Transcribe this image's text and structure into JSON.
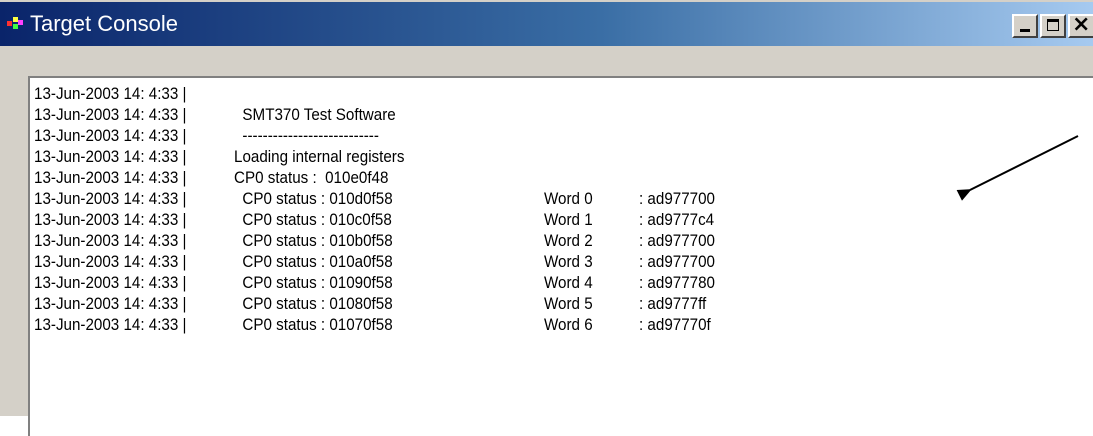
{
  "window": {
    "title": "Target Console",
    "controls": {
      "minimize": "_",
      "maximize": "□",
      "close": "×"
    }
  },
  "console": {
    "lines": [
      {
        "timestamp": "13-Jun-2003 14: 4:33 |",
        "message": "",
        "word": "",
        "value": ""
      },
      {
        "timestamp": "13-Jun-2003 14: 4:33 |",
        "message": "  SMT370 Test Software",
        "word": "",
        "value": ""
      },
      {
        "timestamp": "13-Jun-2003 14: 4:33 |",
        "message": "  ---------------------------",
        "word": "",
        "value": ""
      },
      {
        "timestamp": "13-Jun-2003 14: 4:33 |",
        "message": "Loading internal registers",
        "word": "",
        "value": ""
      },
      {
        "timestamp": "13-Jun-2003 14: 4:33 |",
        "message": "CP0 status :  010e0f48",
        "word": "",
        "value": ""
      },
      {
        "timestamp": "13-Jun-2003 14: 4:33 |",
        "message": "  CP0 status : 010d0f58",
        "word": "Word 0",
        "value": ": ad977700"
      },
      {
        "timestamp": "13-Jun-2003 14: 4:33 |",
        "message": "  CP0 status : 010c0f58",
        "word": "Word 1",
        "value": ": ad9777c4"
      },
      {
        "timestamp": "13-Jun-2003 14: 4:33 |",
        "message": "  CP0 status : 010b0f58",
        "word": "Word 2",
        "value": ": ad977700"
      },
      {
        "timestamp": "13-Jun-2003 14: 4:33 |",
        "message": "  CP0 status : 010a0f58",
        "word": "Word 3",
        "value": ": ad977700"
      },
      {
        "timestamp": "13-Jun-2003 14: 4:33 |",
        "message": "  CP0 status : 01090f58",
        "word": "Word 4",
        "value": ": ad977780"
      },
      {
        "timestamp": "13-Jun-2003 14: 4:33 |",
        "message": "  CP0 status : 01080f58",
        "word": "Word 5",
        "value": ": ad9777ff"
      },
      {
        "timestamp": "13-Jun-2003 14: 4:33 |",
        "message": "  CP0 status : 01070f58",
        "word": "Word 6",
        "value": ": ad97770f"
      }
    ]
  },
  "colors": {
    "titlebar_start": "#0a246a",
    "titlebar_end": "#a6caf0",
    "window_face": "#d4d0c8",
    "console_bg": "#ffffff"
  }
}
